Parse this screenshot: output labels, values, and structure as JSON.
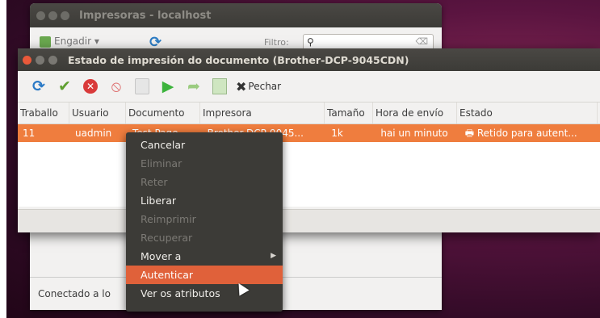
{
  "colors": {
    "accent": "#ef7d3e",
    "menu_highlight": "#e0613a",
    "titlebar": "#3c3b37"
  },
  "back_window": {
    "title": "Impresoras - localhost",
    "add_label": "Engadir",
    "filter_label": "Filtro:",
    "status_text": "Conectado a lo"
  },
  "dialog": {
    "title": "Estado de impresión do documento (Brother-DCP-9045CDN)",
    "toolbar": {
      "close_label": "Pechar"
    },
    "columns": [
      "Traballo",
      "Usuario",
      "Documento",
      "Impresora",
      "Tamaño",
      "Hora de envío",
      "Estado"
    ],
    "rows": [
      [
        "11",
        "uadmin",
        "Test Page",
        "Brother-DCP-9045...",
        "1k",
        "hai un minuto",
        "Retido para autent..."
      ]
    ]
  },
  "context_menu": {
    "items": [
      {
        "label": "Cancelar",
        "state": "enabled"
      },
      {
        "label": "Eliminar",
        "state": "disabled"
      },
      {
        "label": "Reter",
        "state": "disabled"
      },
      {
        "label": "Liberar",
        "state": "enabled"
      },
      {
        "label": "Reimprimir",
        "state": "disabled"
      },
      {
        "label": "Recuperar",
        "state": "disabled"
      },
      {
        "label": "Mover a",
        "state": "enabled",
        "submenu": true
      },
      {
        "label": "Autenticar",
        "state": "highlighted"
      },
      {
        "label": "Ver os atributos",
        "state": "enabled"
      }
    ]
  }
}
